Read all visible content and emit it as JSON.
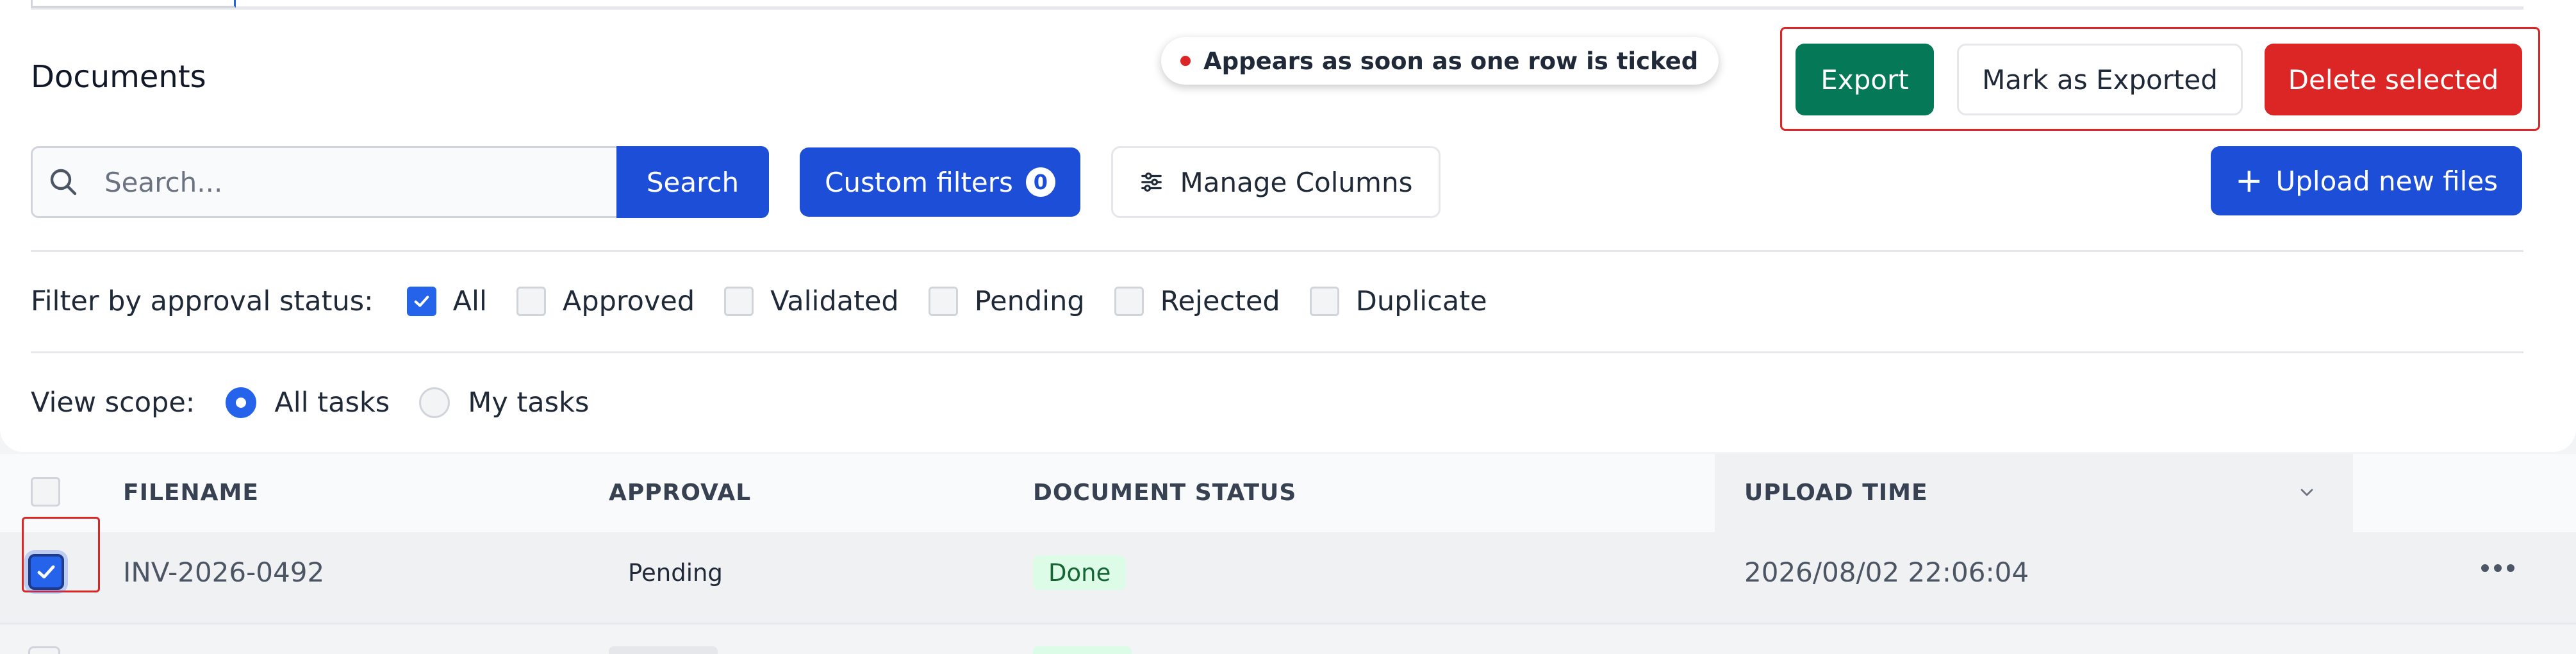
{
  "page": {
    "title": "Documents",
    "hint": "Appears as soon as one row is ticked"
  },
  "bulk_actions": {
    "export": "Export",
    "mark_exported": "Mark as Exported",
    "delete_selected": "Delete selected"
  },
  "toolbar": {
    "search_placeholder": "Search...",
    "search_button": "Search",
    "custom_filters": "Custom filters",
    "custom_filters_count": "0",
    "manage_columns": "Manage Columns",
    "upload": "Upload new files"
  },
  "filters": {
    "label": "Filter by approval status:",
    "options": [
      {
        "label": "All",
        "checked": true
      },
      {
        "label": "Approved",
        "checked": false
      },
      {
        "label": "Validated",
        "checked": false
      },
      {
        "label": "Pending",
        "checked": false
      },
      {
        "label": "Rejected",
        "checked": false
      },
      {
        "label": "Duplicate",
        "checked": false
      }
    ]
  },
  "scope": {
    "label": "View scope:",
    "options": [
      {
        "label": "All tasks",
        "selected": true
      },
      {
        "label": "My tasks",
        "selected": false
      }
    ]
  },
  "table": {
    "columns": [
      "FILENAME",
      "APPROVAL",
      "DOCUMENT STATUS",
      "UPLOAD TIME"
    ],
    "rows": [
      {
        "filename": "INV-2026-0492",
        "approval": "Pending",
        "status": "Done",
        "upload_time": "2026/08/02 22:06:04",
        "selected": true
      }
    ]
  },
  "colors": {
    "primary": "#1d4ed8",
    "export": "#047857",
    "danger": "#dc2626",
    "done_bg": "#dcfce7",
    "done_text": "#166534"
  },
  "icons": [
    "search-icon",
    "sliders-icon",
    "plus-icon",
    "check-icon",
    "chevron-down-icon",
    "more-icon"
  ]
}
